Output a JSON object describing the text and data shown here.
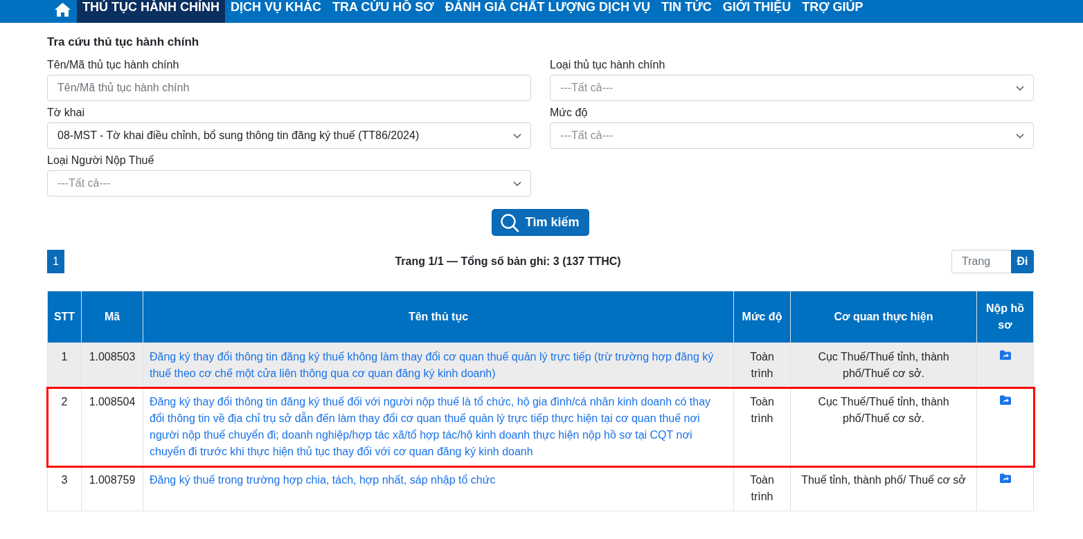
{
  "nav": {
    "items": [
      {
        "label": "THỦ TỤC HÀNH CHÍNH",
        "selected": true
      },
      {
        "label": "DỊCH VỤ KHÁC",
        "selected": false
      },
      {
        "label": "TRA CỨU HỒ SƠ",
        "selected": false
      },
      {
        "label": "ĐÁNH GIÁ CHẤT LƯỢNG DỊCH VỤ",
        "selected": false
      },
      {
        "label": "TIN TỨC",
        "selected": false
      },
      {
        "label": "GIỚI THIỆU",
        "selected": false
      },
      {
        "label": "TRỢ GIÚP",
        "selected": false
      }
    ]
  },
  "search_form": {
    "title": "Tra cứu thủ tục hành chính",
    "fields": [
      {
        "kind": "text",
        "label": "Tên/Mã thủ tục hành chính",
        "placeholder": "Tên/Mã thủ tục hành chính"
      },
      {
        "kind": "select",
        "label": "Loại thủ tục hành chính",
        "placeholder": "---Tất cả---"
      },
      {
        "kind": "select",
        "label": "Tờ khai",
        "value": "08-MST - Tờ khai điều chỉnh, bổ sung thông tin đăng ký thuế (TT86/2024)"
      },
      {
        "kind": "select",
        "label": "Mức độ",
        "placeholder": "---Tất cả---"
      },
      {
        "kind": "select",
        "label": "Loại Người Nộp Thuế",
        "placeholder": "---Tất cả---"
      }
    ],
    "search_button": "Tìm kiếm"
  },
  "pagination": {
    "pages": [
      {
        "label": "1",
        "selected": true
      }
    ],
    "summary": "Trang 1/1 — Tổng số bản ghi: 3 (137 TTHC)",
    "page_input_placeholder": "Trang",
    "go_button": "Đi"
  },
  "table": {
    "columns": [
      "STT",
      "Mã",
      "Tên thủ tục",
      "Mức độ",
      "Cơ quan thực hiện",
      "Nộp hồ sơ"
    ],
    "rows": [
      {
        "stt": "1",
        "code": "1.008503",
        "name": "Đăng ký thay đổi thông tin đăng ký thuế không làm thay đổi cơ quan thuế quản lý trực tiếp (trừ trường hợp đăng ký thuế theo cơ chế một cửa liên thông qua cơ quan đăng ký kinh doanh)",
        "level": "Toàn trình",
        "agency": "Cục Thuế/Thuế tỉnh, thành phố/Thuế cơ sở.",
        "highlighted": false
      },
      {
        "stt": "2",
        "code": "1.008504",
        "name": "Đăng ký thay đổi thông tin đăng ký thuế đối với người nộp thuế là tổ chức, hộ gia đình/cá nhân kinh doanh có thay đổi thông tin về địa chỉ trụ sở dẫn đến làm thay đổi cơ quan thuế quản lý trực tiếp thực hiện tại cơ quan thuế nơi người nộp thuế chuyển đi; doanh nghiệp/hợp tác xã/tổ hợp tác/hộ kinh doanh thực hiện nộp hồ sơ tại CQT nơi chuyển đi trước khi thực hiện thủ tục thay đổi với cơ quan đăng ký kinh doanh",
        "level": "Toàn trình",
        "agency": "Cục Thuế/Thuế tỉnh, thành phố/Thuế cơ sở.",
        "highlighted": true
      },
      {
        "stt": "3",
        "code": "1.008759",
        "name": "Đăng ký thuế trong trường hợp chia, tách, hợp nhất, sáp nhập tổ chức",
        "level": "Toàn trình",
        "agency": "Thuế tỉnh, thành phố/ Thuế cơ sở",
        "highlighted": false
      }
    ]
  }
}
